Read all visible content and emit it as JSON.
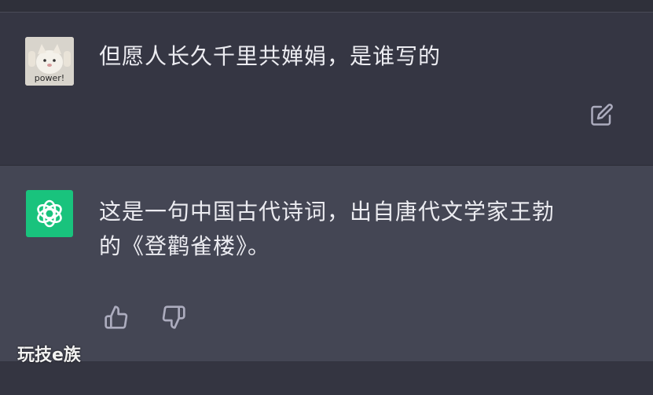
{
  "conversation": {
    "user_message": {
      "avatar_caption": "power!",
      "text": "但愿人长久千里共婵娟，是谁写的",
      "actions": {
        "edit_icon": "edit-icon"
      }
    },
    "assistant_message": {
      "avatar_icon": "openai-logo-icon",
      "text_line1": "这是一句中国古代诗词，出自唐代文学家王勃",
      "text_line2": "的《登鹳雀楼》。",
      "actions": {
        "thumbs_up_icon": "thumbs-up-icon",
        "thumbs_down_icon": "thumbs-down-icon"
      }
    }
  },
  "watermark": {
    "text": "玩技e族"
  },
  "colors": {
    "background": "#343541",
    "assistant_background": "#444654",
    "bot_avatar": "#19c37d",
    "text": "#ececf1",
    "icon": "#acacbe"
  }
}
